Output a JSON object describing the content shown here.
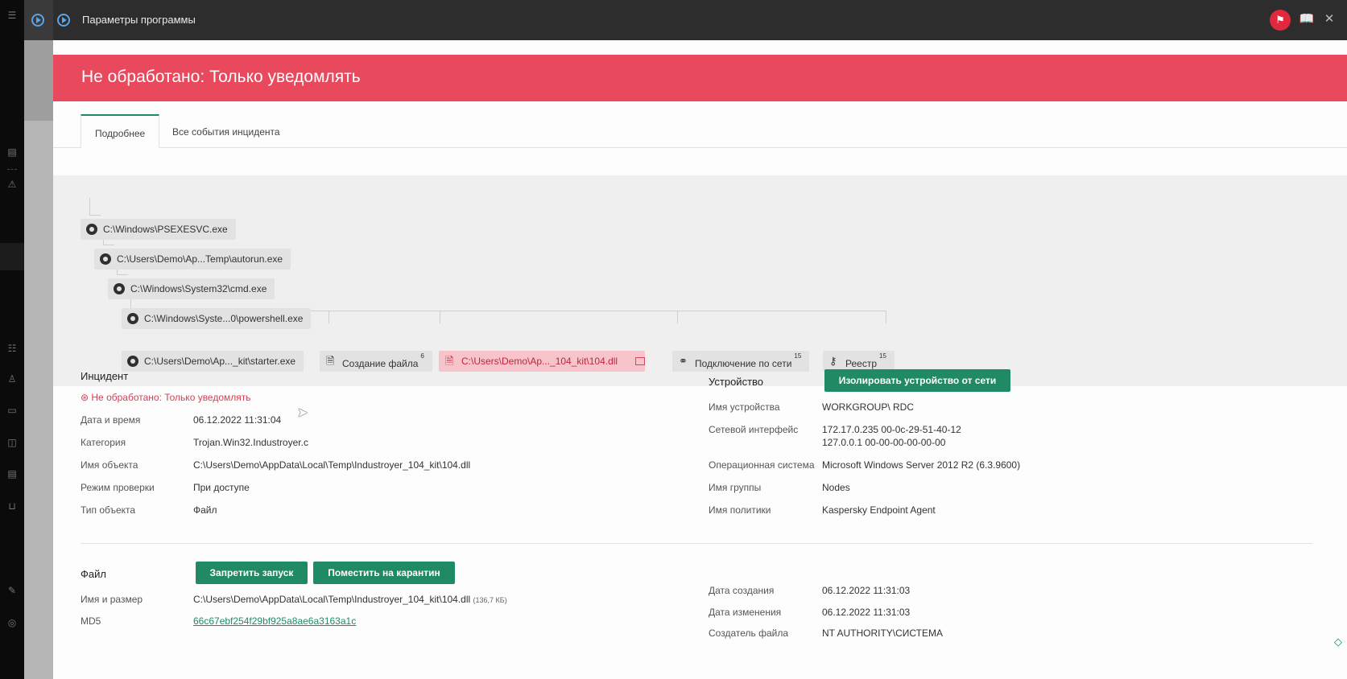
{
  "window": {
    "title": "Параметры программы"
  },
  "banner": {
    "title": "Не обработано: Только уведомлять"
  },
  "tabs": [
    {
      "label": "Подробнее",
      "active": true
    },
    {
      "label": "Все события инцидента",
      "active": false
    }
  ],
  "tree": {
    "nodes": [
      {
        "label": "C:\\Windows\\PSEXESVC.exe",
        "icon": "gear-icon"
      },
      {
        "label": "C:\\Users\\Demo\\Ap...Temp\\autorun.exe",
        "icon": "gear-icon"
      },
      {
        "label": "C:\\Windows\\System32\\cmd.exe",
        "icon": "gear-icon"
      },
      {
        "label": "C:\\Windows\\Syste...0\\powershell.exe",
        "icon": "gear-icon"
      }
    ],
    "leaves": [
      {
        "label": "C:\\Users\\Demo\\Ap..._kit\\starter.exe",
        "icon": "gear-icon",
        "count": ""
      },
      {
        "label": "Создание файла",
        "icon": "file-icon",
        "count": "6"
      },
      {
        "label": "C:\\Users\\Demo\\Ap..._104_kit\\104.dll",
        "icon": "file-icon",
        "count": "",
        "highlighted": true
      },
      {
        "label": "Подключение по сети",
        "icon": "network-icon",
        "count": "15"
      },
      {
        "label": "Реестр",
        "icon": "key-icon",
        "count": "15"
      }
    ]
  },
  "incident": {
    "title": "Инцидент",
    "status": "Не обработано: Только уведомлять",
    "fields": [
      {
        "label": "Дата и время",
        "value": "06.12.2022 11:31:04"
      },
      {
        "label": "Категория",
        "value": "Trojan.Win32.Industroyer.c"
      },
      {
        "label": "Имя объекта",
        "value": "C:\\Users\\Demo\\AppData\\Local\\Temp\\Industroyer_104_kit\\104.dll"
      },
      {
        "label": "Режим проверки",
        "value": "При доступе"
      },
      {
        "label": "Тип объекта",
        "value": "Файл"
      }
    ]
  },
  "device": {
    "title": "Устройство",
    "isolate_button": "Изолировать устройство от сети",
    "fields": [
      {
        "label": "Имя устройства",
        "value": "WORKGROUP\\ RDC"
      },
      {
        "label": "Сетевой интерфейс",
        "value": "172.17.0.235   00-0c-29-51-40-12",
        "value2": "127.0.0.1   00-00-00-00-00-00"
      },
      {
        "label": "Операционная система",
        "value": "Microsoft Windows Server 2012 R2 (6.3.9600)"
      },
      {
        "label": "Имя группы",
        "value": "Nodes"
      },
      {
        "label": "Имя политики",
        "value": "Kaspersky Endpoint Agent"
      }
    ]
  },
  "file": {
    "title": "Файл",
    "block_button": "Запретить запуск",
    "quarantine_button": "Поместить на карантин",
    "name_label": "Имя и размер",
    "name_value": "C:\\Users\\Demo\\AppData\\Local\\Temp\\Industroyer_104_kit\\104.dll",
    "size_value": "(136,7 КБ)",
    "md5_label": "MD5",
    "md5_value": "66c67ebf254f29bf925a8ae6a3163a1c",
    "created_label": "Дата создания",
    "created_value": "06.12.2022 11:31:03",
    "modified_label": "Дата изменения",
    "modified_value": "06.12.2022 11:31:03",
    "creator_label": "Создатель файла",
    "creator_value": "NT AUTHORITY\\СИСТЕМА"
  },
  "colors": {
    "banner": "#e9495d",
    "accent": "#1f8a63",
    "titlebar": "#2d2d2d"
  }
}
